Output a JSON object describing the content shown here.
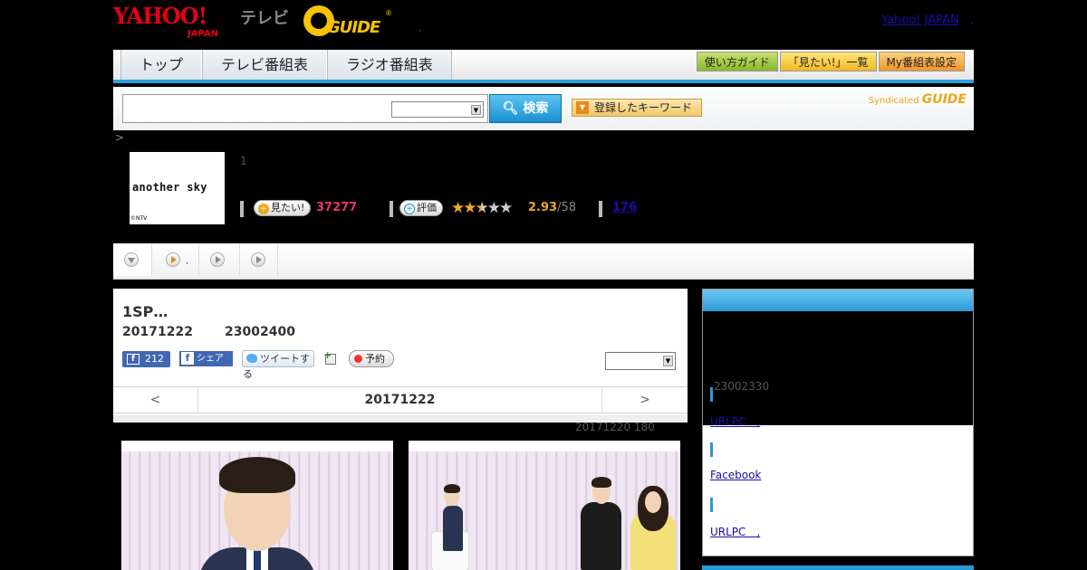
{
  "header": {
    "yahoo_logo": "YAHOO!",
    "yahoo_logo_sub": "JAPAN",
    "tv_logo": "テレビ",
    "gguide_logo": "GUIDE",
    "gguide_reg": "®",
    "dot": ",",
    "yahoo_japan_link": "Yahoo! JAPAN",
    "yahoo_japan_link_suffix": ","
  },
  "nav": {
    "tabs": [
      {
        "label": "トップ"
      },
      {
        "label": "テレビ番組表"
      },
      {
        "label": "ラジオ番組表"
      }
    ],
    "buttons": {
      "guide": "使い方ガイド",
      "mitai_list": "「見たい!」一覧",
      "my_schedule": "My番組表設定"
    }
  },
  "search": {
    "input_value": "",
    "select_value": "",
    "search_button": "検索",
    "keyword_button": "登録したキーワード",
    "syndicated_label": "Syndicated",
    "syndicated_logo": "GUIDE"
  },
  "breadcrumb": ">",
  "program": {
    "thumb_title": "another sky",
    "thumb_copyright": "©NTV",
    "number": "1",
    "mitai_button": "見たい!",
    "mitai_count": "37277",
    "rate_button": "評価",
    "rating_value": "2.93",
    "rating_count": "/58",
    "stars_filled": 2.5,
    "comment_count": "176"
  },
  "tabs_strip": {
    "dot": ","
  },
  "episode": {
    "title": "1SP…",
    "date": "20171222",
    "time": "23002400",
    "fb_like_count": "212",
    "fb_share": "シェア",
    "tweet": "ツイートする",
    "reserve": "予約",
    "select_value": "",
    "day_prev": "<",
    "day_current": "20171222",
    "day_next": ">",
    "meta": "20171220  180"
  },
  "sidebar": {
    "time": "23002330",
    "links": [
      "URLPC　,",
      "Facebook",
      "URLPC　,"
    ]
  },
  "colors": {
    "accent_blue": "#2a9ad6",
    "yahoo_red": "#e60012",
    "gguide_yellow": "#f5c400",
    "mitai_pink": "#e8336b",
    "rating_orange": "#e8a91c"
  }
}
